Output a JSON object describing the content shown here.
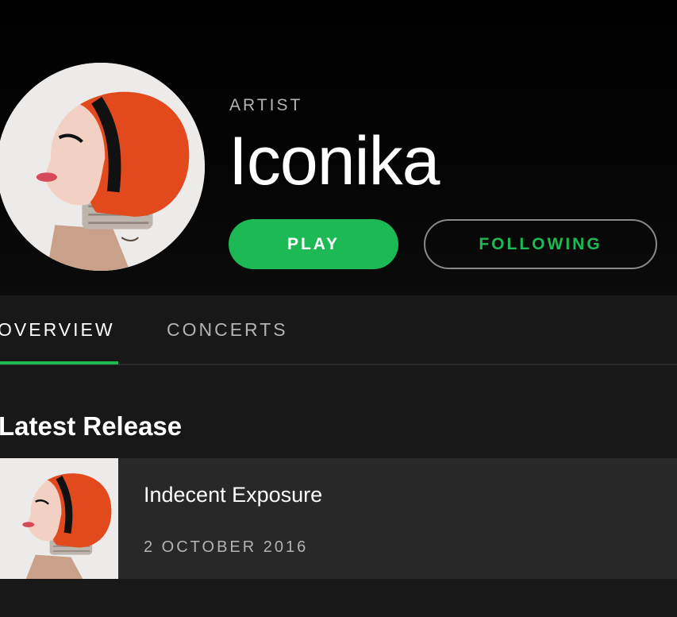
{
  "artist": {
    "kicker": "ARTIST",
    "name": "Iconika",
    "image_icon": "artist-portrait-image"
  },
  "actions": {
    "play_label": "PLAY",
    "following_label": "FOLLOWING"
  },
  "tabs": [
    {
      "label": "OVERVIEW",
      "active": true
    },
    {
      "label": "CONCERTS",
      "active": false
    }
  ],
  "latest_release": {
    "heading": "Latest Release",
    "title": "Indecent Exposure",
    "date": "2 OCTOBER 2016"
  },
  "colors": {
    "accent": "#1db954",
    "background": "#181818",
    "header_background": "#000000",
    "row_background": "#282828",
    "secondary_text": "#b3b3b3"
  }
}
